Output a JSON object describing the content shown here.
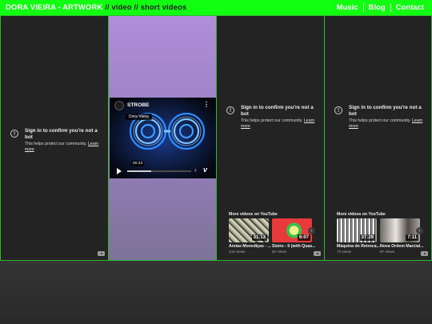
{
  "header": {
    "brand": "DORA VIEIRA - ARTWORK",
    "breadcrumb": " // video // short videos",
    "nav": [
      "Music",
      "Blog",
      "Contact"
    ]
  },
  "colors": {
    "accent": "#11ff11",
    "panel_border": "#2fb82f"
  },
  "signin": {
    "title": "Sign in to confirm you're not a bot",
    "subtitle": "This helps protect our community.",
    "link": "Learn more"
  },
  "vimeo": {
    "title": "STROBE",
    "author": "Dora Vieira",
    "time": "00:43",
    "progress": 0.37
  },
  "more_videos": {
    "heading": "More videos on YouTube",
    "panel3": [
      {
        "title": "Areias Movediças - ...",
        "views": "144 views",
        "duration": "31:13"
      },
      {
        "title": "Sistro - 9 (with Quas...",
        "views": "62 views",
        "duration": "6:07"
      }
    ],
    "panel4": [
      {
        "title": "Máquina do Retroca...",
        "views": "73 views",
        "duration": "37:29"
      },
      {
        "title": "Nova Ordem Marcial...",
        "views": "57 views",
        "duration": "7:11"
      }
    ]
  },
  "icons": [
    "warning-icon",
    "youtube-icon",
    "play-icon",
    "vimeo-logo-icon",
    "menu-dots-icon",
    "chevron-right-icon"
  ]
}
